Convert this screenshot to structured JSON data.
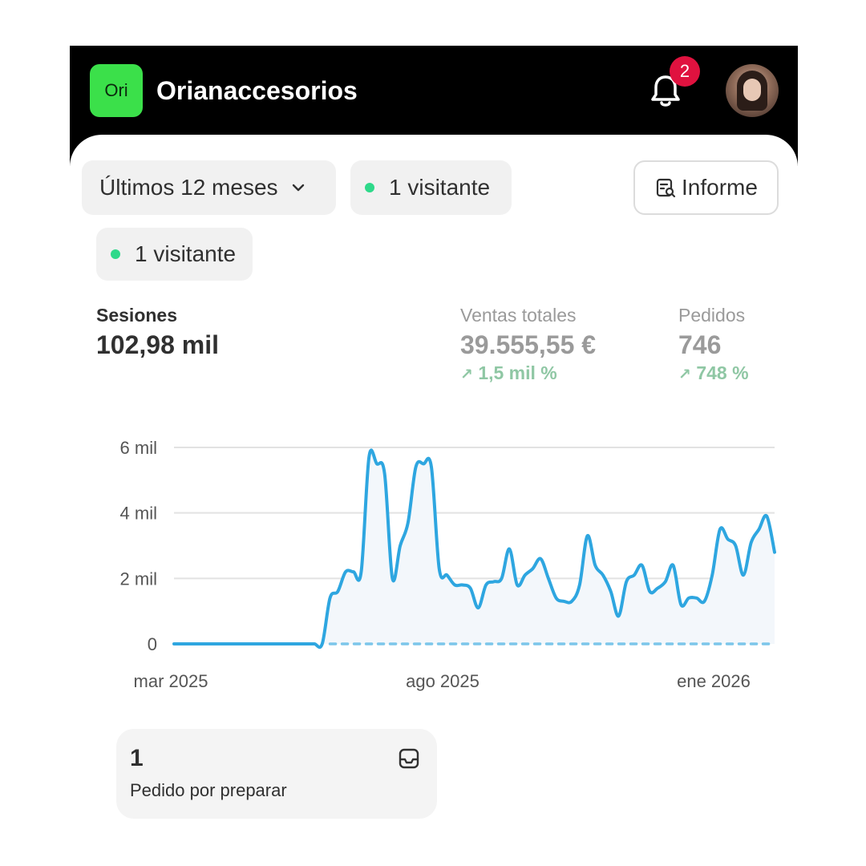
{
  "header": {
    "logo_text": "Ori",
    "logo_color": "#3be04a",
    "store_name": "Orianaccesorios",
    "notification_count": "2",
    "notification_icon": "bell-icon",
    "avatar": "user-avatar"
  },
  "filters": {
    "date_range": "Últimos 12 meses",
    "visitors_chip_1": "1 visitante",
    "visitors_chip_2": "1 visitante",
    "report_button": "Informe",
    "live_dot_color": "#2ed98a"
  },
  "metrics": {
    "sessions": {
      "label": "Sesiones",
      "value": "102,98 mil"
    },
    "sales": {
      "label": "Ventas totales",
      "value": "39.555,55 €",
      "delta": "1,5 mil %"
    },
    "orders": {
      "label": "Pedidos",
      "value": "746",
      "delta": "748 %"
    }
  },
  "chart_data": {
    "type": "area",
    "y_ticks": [
      "0",
      "2 mil",
      "4 mil",
      "6 mil"
    ],
    "x_ticks": [
      "mar 2025",
      "ago 2025",
      "ene 2026"
    ],
    "ylim": [
      0,
      6000
    ],
    "series": [
      {
        "color": "#2ea6e0",
        "values": [
          0,
          0,
          0,
          0,
          0,
          0,
          0,
          0,
          0,
          0,
          0,
          0,
          0,
          0,
          0,
          0,
          0,
          0,
          0,
          0,
          1400,
          1600,
          2200,
          2200,
          2200,
          5700,
          5500,
          5200,
          2000,
          3000,
          3700,
          5400,
          5500,
          5400,
          2300,
          2100,
          1800,
          1800,
          1700,
          1100,
          1800,
          1900,
          2000,
          2900,
          1800,
          2100,
          2300,
          2600,
          2000,
          1400,
          1300,
          1300,
          1800,
          3300,
          2400,
          2100,
          1600,
          850,
          1900,
          2100,
          2400,
          1600,
          1700,
          1900,
          2400,
          1200,
          1400,
          1400,
          1300,
          2100,
          3500,
          3200,
          3000,
          2100,
          3100,
          3500,
          3900,
          2800
        ]
      },
      {
        "style": "dashed",
        "color": "#7cc6ea",
        "values": [
          0,
          0,
          0,
          0,
          0,
          0,
          0,
          0,
          0,
          0,
          0,
          0,
          0,
          0,
          0,
          0,
          0,
          0,
          0,
          0,
          0,
          0,
          0,
          0,
          0,
          0,
          0,
          0,
          0,
          0,
          0,
          0,
          0,
          0,
          0,
          0,
          0,
          0,
          0,
          0,
          0,
          0,
          0,
          0,
          0,
          0,
          0,
          0,
          0,
          0,
          0,
          0,
          0,
          0,
          0,
          0,
          0,
          0,
          0,
          0,
          0,
          0,
          0,
          0,
          0,
          0,
          0,
          0,
          0,
          0,
          0,
          0,
          0,
          0,
          0,
          0,
          0,
          0
        ]
      }
    ],
    "grid": true
  },
  "todo": {
    "count": "1",
    "label": "Pedido por preparar",
    "icon": "inbox-icon"
  }
}
